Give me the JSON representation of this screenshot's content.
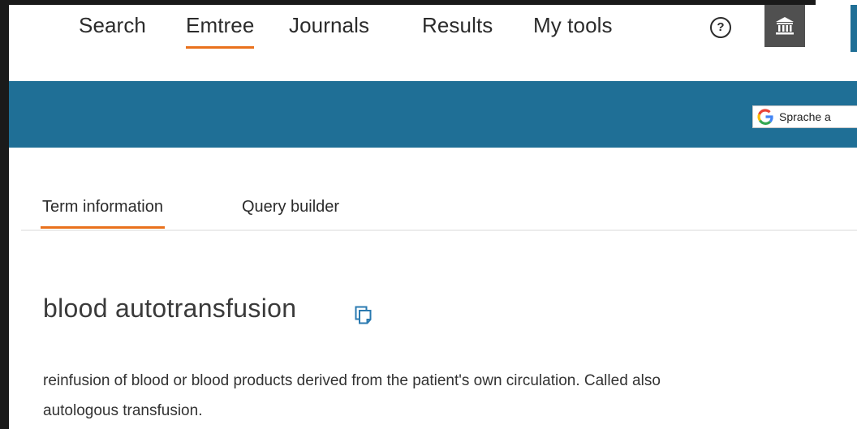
{
  "nav": {
    "items": [
      {
        "label": "Search",
        "active": false
      },
      {
        "label": "Emtree",
        "active": true
      },
      {
        "label": "Journals",
        "active": false
      },
      {
        "label": "Results",
        "active": false
      },
      {
        "label": "My tools",
        "active": false
      }
    ],
    "help_icon": "?",
    "institution_icon": "institution-icon"
  },
  "translate": {
    "label": "Sprache a",
    "logo": "google-g-icon"
  },
  "tabs": [
    {
      "label": "Term information",
      "active": true
    },
    {
      "label": "Query builder",
      "active": false
    }
  ],
  "term": {
    "title": "blood autotransfusion",
    "definition_line1": "reinfusion of blood or blood products derived from the patient's own circulation. Called also",
    "definition_line2": "autologous transfusion."
  },
  "colors": {
    "accent": "#e9711c",
    "banner": "#1f6f96",
    "icon_blue": "#2a7ab0"
  }
}
